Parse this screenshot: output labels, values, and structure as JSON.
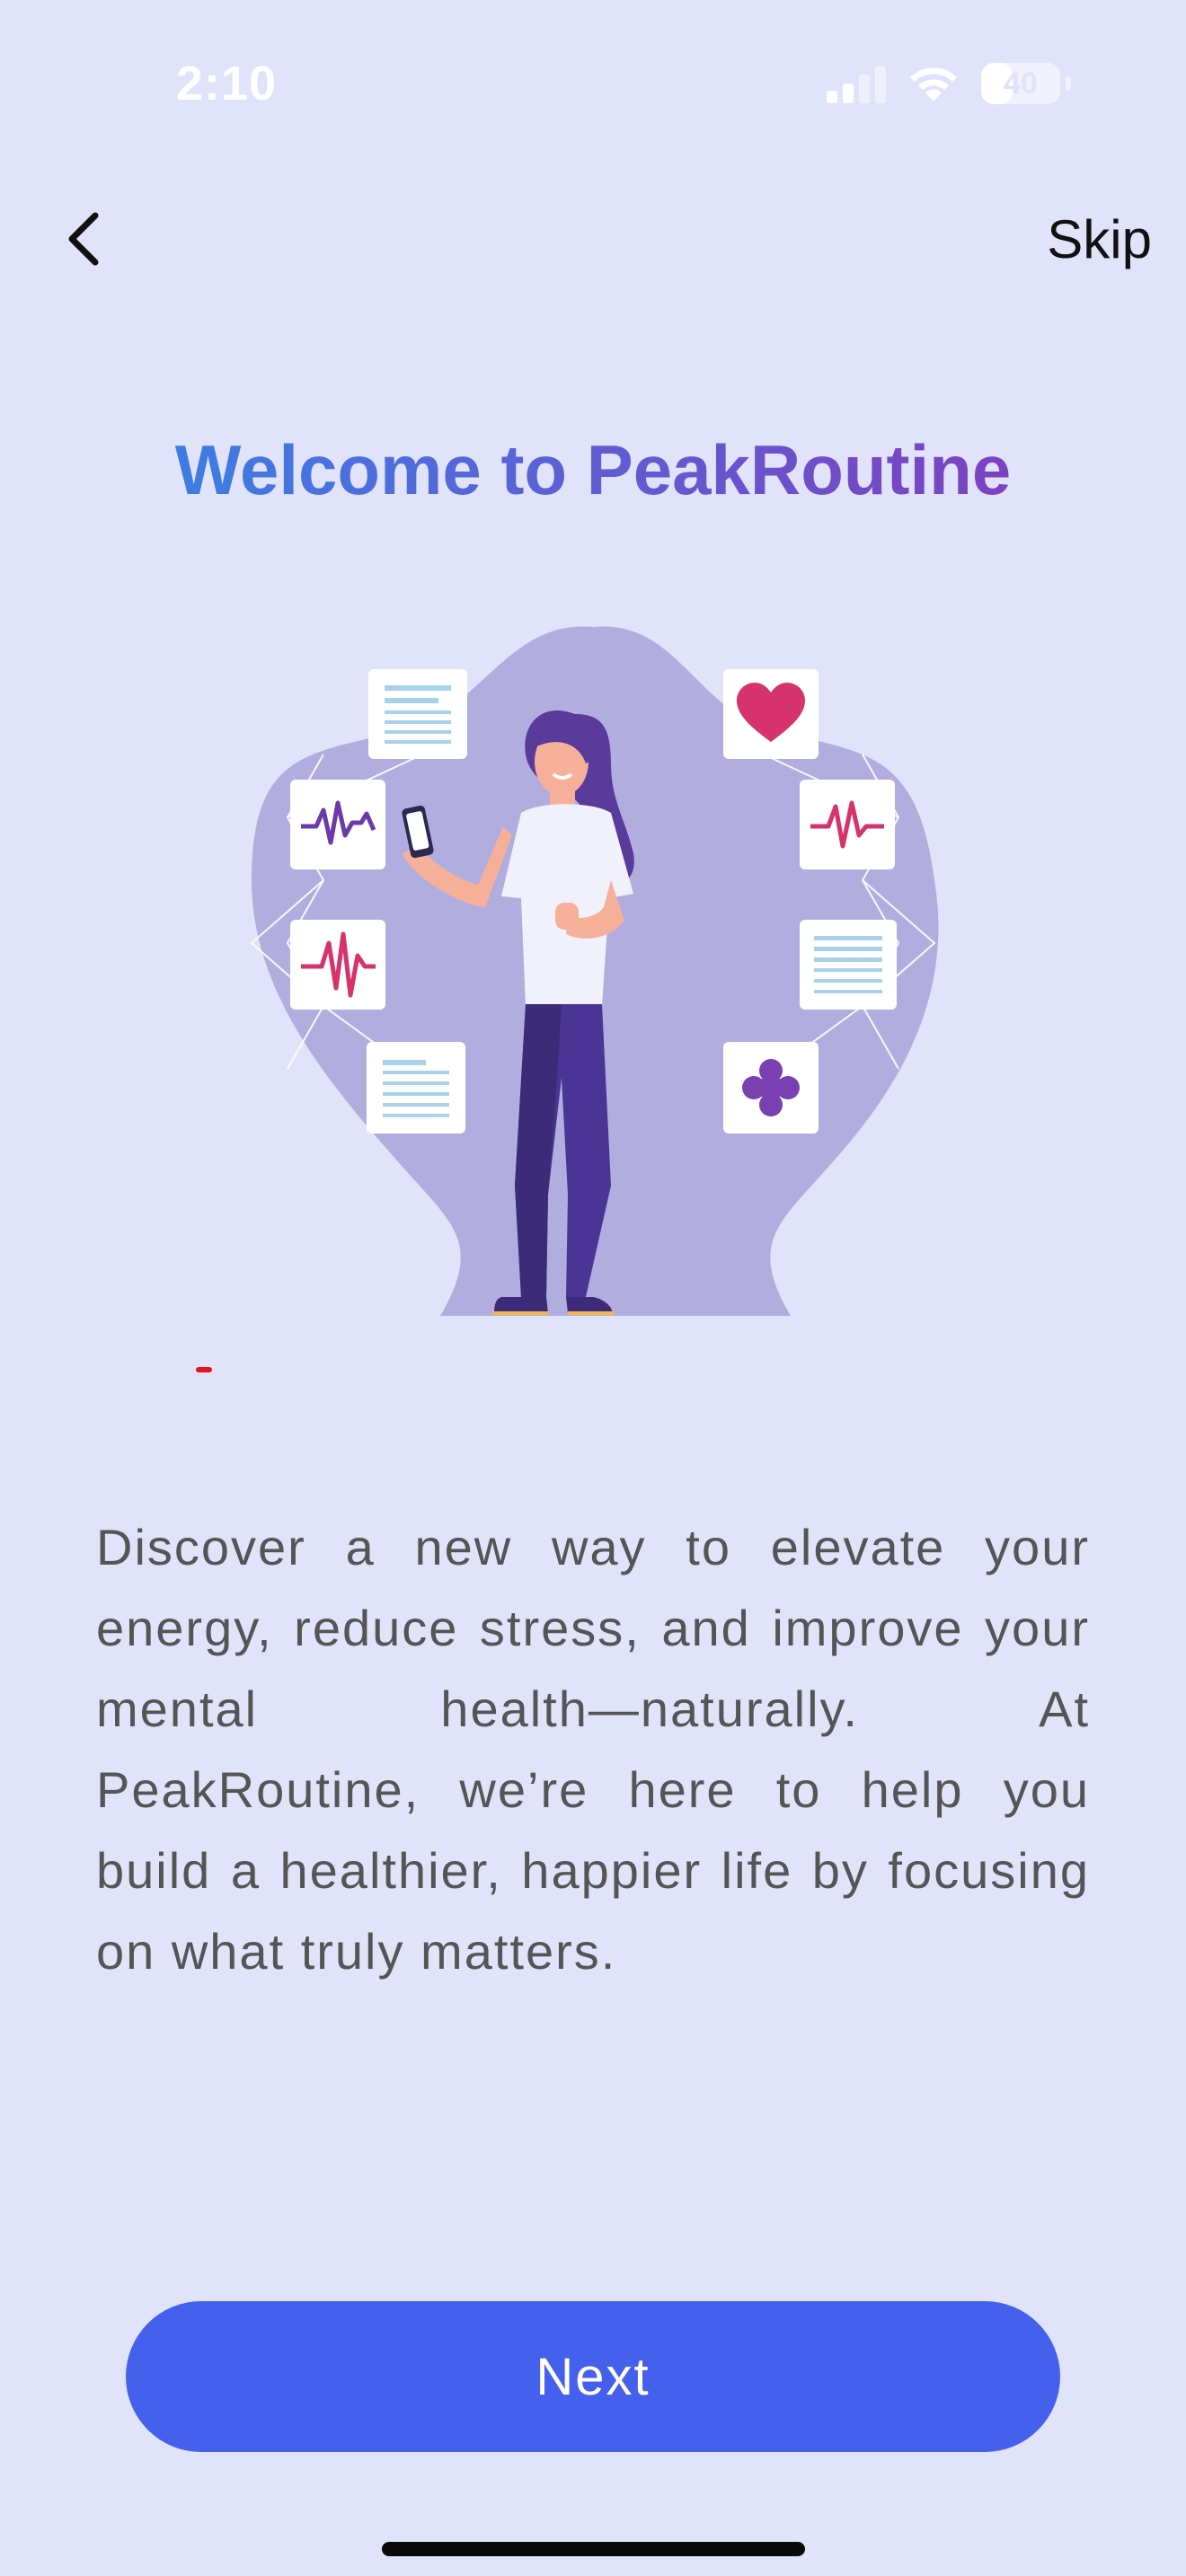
{
  "status_bar": {
    "time": "2:10",
    "battery_percent": "40",
    "signal_bars_active": 2,
    "signal_bars_total": 4
  },
  "nav": {
    "back_icon": "chevron-left-icon",
    "skip_label": "Skip"
  },
  "onboarding": {
    "title": "Welcome to PeakRoutine",
    "body": "Discover a new way to elevate your energy, reduce stress, and improve your mental health—naturally. At PeakRoutine, we’re here to help you build a healthier, happier life by focusing on what truly matters.",
    "illustration_icons": [
      "document-icon",
      "heart-icon",
      "pulse-icon",
      "pulse-icon",
      "pulse-icon",
      "document-icon",
      "document-icon",
      "medical-cross-icon"
    ]
  },
  "footer": {
    "next_label": "Next"
  },
  "colors": {
    "background": "#e0e3fa",
    "primary_button": "#4560ec",
    "title_gradient_start": "#2f8ae8",
    "title_gradient_end": "#8a35b8",
    "body_text": "#555555"
  }
}
